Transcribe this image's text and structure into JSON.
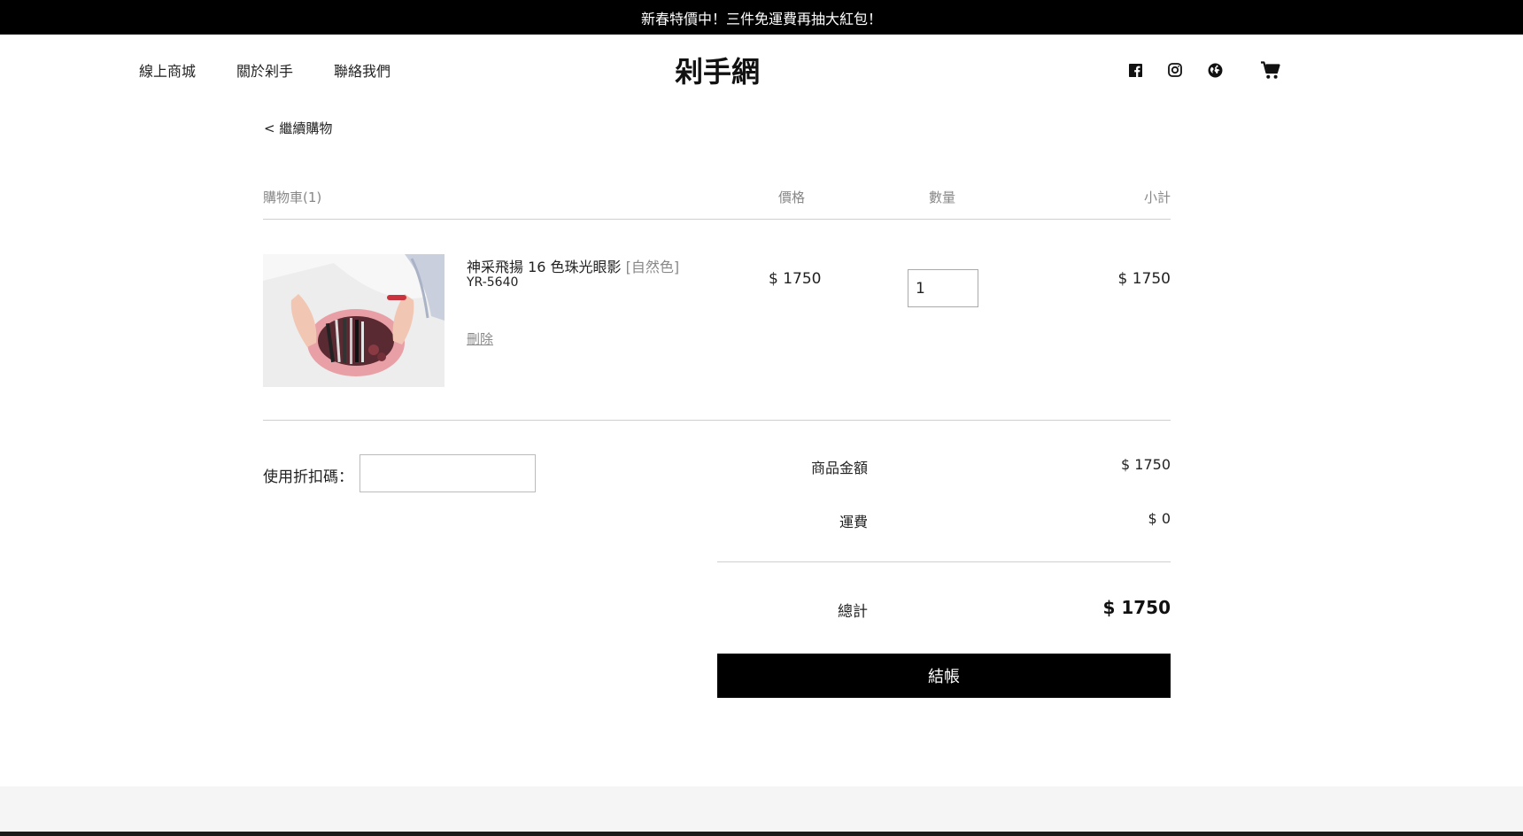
{
  "announcement": "新春特價中！三件免運費再抽大紅包！",
  "nav": {
    "items": [
      "線上商城",
      "關於剁手",
      "聯絡我們"
    ]
  },
  "logo": "剁手網",
  "header_icons": [
    "facebook-icon",
    "instagram-icon",
    "globe-icon",
    "cart-icon"
  ],
  "back_link": "< 繼續購物",
  "cart_table": {
    "headers": {
      "cart": "購物車(1)",
      "price": "價格",
      "quantity": "數量",
      "subtotal": "小計"
    }
  },
  "cart_item": {
    "name": "神采飛揚 16 色珠光眼影",
    "variant": "[自然色]",
    "sku": "YR-5640",
    "delete_label": "刪除",
    "price": "$ 1750",
    "quantity": "1",
    "subtotal": "$ 1750"
  },
  "coupon": {
    "label": "使用折扣碼：",
    "value": ""
  },
  "summary": {
    "items_label": "商品金額",
    "items_value": "$ 1750",
    "shipping_label": "運費",
    "shipping_value": "$ 0",
    "total_label": "總計",
    "total_value": "$ 1750"
  },
  "checkout_label": "結帳",
  "colors": {
    "announcement_bg": "#000000",
    "checkout_bg": "#000000",
    "footer_bg": "#f5f5f5",
    "muted_text": "#888888"
  }
}
